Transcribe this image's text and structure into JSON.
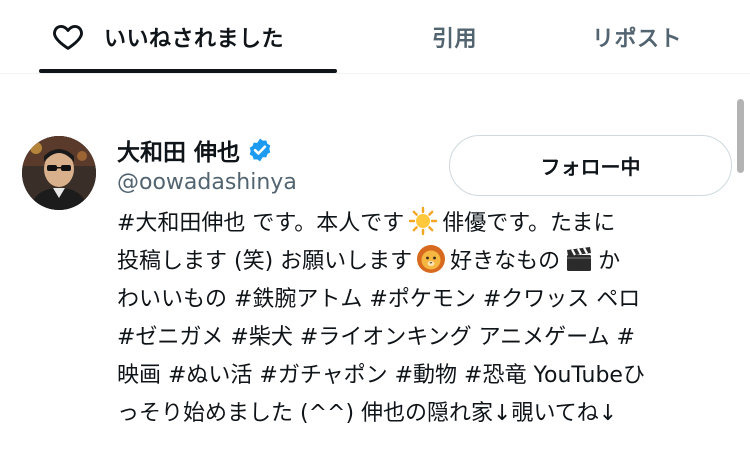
{
  "tabs": {
    "likes_label": "いいねされました",
    "quotes_label": "引用",
    "reposts_label": "リポスト"
  },
  "profile": {
    "display_name": "大和田 伸也",
    "handle": "@oowadashinya",
    "follow_button_label": "フォロー中",
    "verified": true,
    "bio": {
      "line1_a": "#大和田伸也 です。本人です",
      "line1_b": "俳優です。たまに",
      "line2_a": "投稿します (笑) お願いします",
      "line2_b": "好きなもの",
      "line2_c": "か",
      "line3": "わいいもの #鉄腕アトム #ポケモン #クワッス ペロ",
      "line4": "#ゼニガメ #柴犬 #ライオンキング アニメゲーム #",
      "line5": "映画 #ぬい活 #ガチャポン #動物 #恐竜 YouTubeひ",
      "line6": "っそり始めました (^^) 伸也の隠れ家↓覗いてね↓"
    }
  },
  "colors": {
    "text_primary": "#0f1419",
    "text_secondary": "#536471",
    "verified_blue": "#1d9bf0",
    "border": "#cfd9de"
  },
  "icons": [
    "heart-icon",
    "verified-badge-icon",
    "sun-emoji-icon",
    "lion-emoji-icon",
    "clapper-emoji-icon"
  ]
}
